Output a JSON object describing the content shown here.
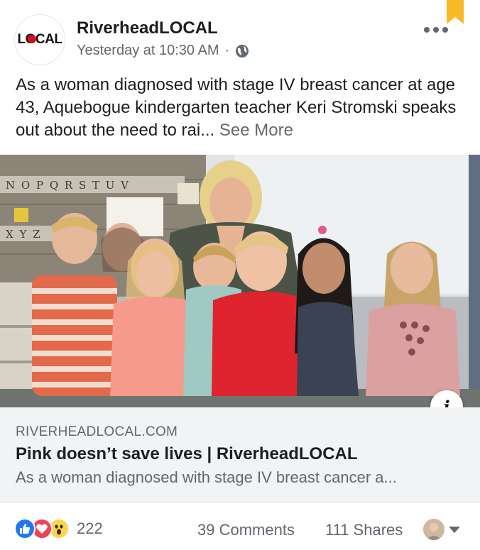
{
  "post": {
    "page_name": "RiverheadLOCAL",
    "logo_text": "LOCAL",
    "timestamp": "Yesterday at 10:30 AM",
    "separator": "·",
    "privacy_icon": "globe-icon",
    "options_icon": "more-horizontal-icon",
    "bookmark_icon": "bookmark-icon",
    "text": "As a woman diagnosed with stage IV breast cancer at age 43, Aquebogue kindergarten teacher Keri Stromski speaks out about the need to rai...",
    "see_more_label": "See More"
  },
  "photo": {
    "wall_letters_row1": "N O P Q R S T U V",
    "wall_letters_row2": "X Y Z",
    "info_label": "i"
  },
  "link_preview": {
    "domain": "RIVERHEADLOCAL.COM",
    "title": "Pink doesn’t save lives | RiverheadLOCAL",
    "description": "As a woman diagnosed with stage IV breast cancer a..."
  },
  "footer": {
    "reaction_icons": [
      "like-icon",
      "love-icon",
      "wow-icon"
    ],
    "reaction_count": "222",
    "comments_label": "39 Comments",
    "shares_label": "111 Shares"
  },
  "colors": {
    "like": "#2078f4",
    "love": "#f33e58",
    "wow": "#fcd44f",
    "bookmark": "#f7b928",
    "link_bg": "#f2f3f5",
    "meta_text": "#65676b"
  }
}
